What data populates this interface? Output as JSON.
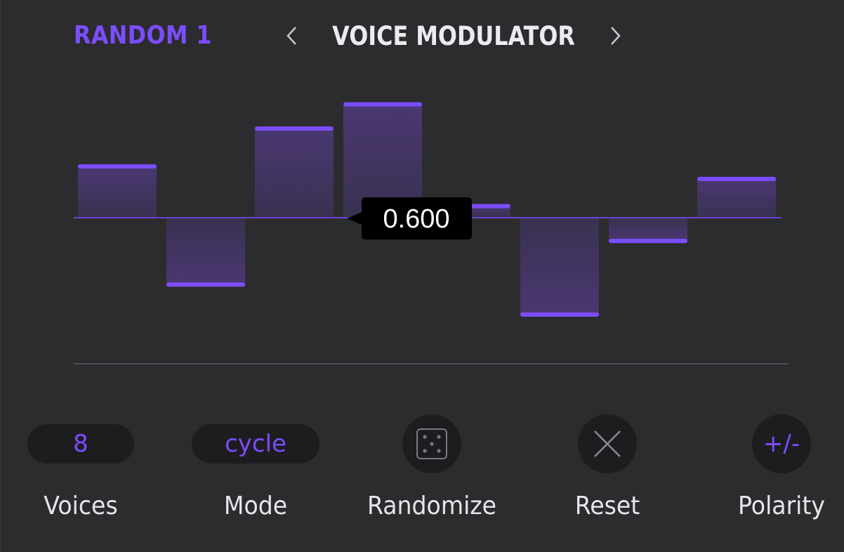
{
  "module": {
    "title": "RANDOM 1",
    "accent_color": "#7c4dff"
  },
  "nav": {
    "prev_icon": "chevron-left-icon",
    "title": "VOICE MODULATOR",
    "next_icon": "chevron-right-icon"
  },
  "graph": {
    "voice_values": [
      0.53,
      -0.69,
      0.92,
      1.17,
      0.12,
      -1.0,
      -0.24,
      0.4
    ],
    "tooltip_value": "0.600",
    "bar_color": "#7c4dff",
    "fill_color": "#453568"
  },
  "controls": {
    "voices": {
      "value": "8",
      "label": "Voices"
    },
    "mode": {
      "value": "cycle",
      "label": "Mode"
    },
    "randomize": {
      "icon": "dice-icon",
      "label": "Randomize"
    },
    "reset": {
      "icon": "close-icon",
      "label": "Reset"
    },
    "polarity": {
      "value": "+/-",
      "label": "Polarity"
    }
  }
}
